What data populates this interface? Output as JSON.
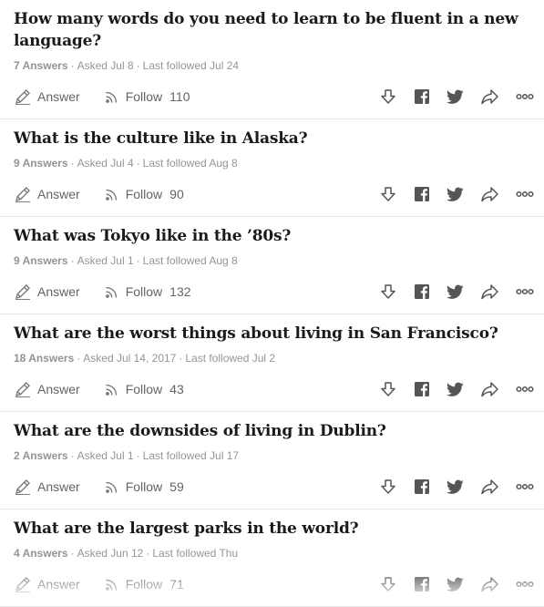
{
  "questions": [
    {
      "title": "How many words do you need to learn to be fluent in a new language?",
      "answers": "7 Answers",
      "asked": "Asked Jul 8",
      "followed": "Last followed Jul 24",
      "answer_label": "Answer",
      "follow_label": "Follow",
      "follow_count": "110"
    },
    {
      "title": "What is the culture like in Alaska?",
      "answers": "9 Answers",
      "asked": "Asked Jul 4",
      "followed": "Last followed Aug 8",
      "answer_label": "Answer",
      "follow_label": "Follow",
      "follow_count": "90"
    },
    {
      "title": "What was Tokyo like in the ’80s?",
      "answers": "9 Answers",
      "asked": "Asked Jul 1",
      "followed": "Last followed Aug 8",
      "answer_label": "Answer",
      "follow_label": "Follow",
      "follow_count": "132"
    },
    {
      "title": "What are the worst things about living in San Francisco?",
      "answers": "18 Answers",
      "asked": "Asked Jul 14, 2017",
      "followed": "Last followed Jul 2",
      "answer_label": "Answer",
      "follow_label": "Follow",
      "follow_count": "43"
    },
    {
      "title": "What are the downsides of living in Dublin?",
      "answers": "2 Answers",
      "asked": "Asked Jul 1",
      "followed": "Last followed Jul 17",
      "answer_label": "Answer",
      "follow_label": "Follow",
      "follow_count": "59"
    },
    {
      "title": "What are the largest parks in the world?",
      "answers": "4 Answers",
      "asked": "Asked Jun 12",
      "followed": "Last followed Thu",
      "answer_label": "Answer",
      "follow_label": "Follow",
      "follow_count": "71"
    }
  ],
  "icons": {
    "answer": "pencil-icon",
    "follow": "follow-signal-icon",
    "downvote": "downvote-arrow-icon",
    "facebook": "facebook-icon",
    "twitter": "twitter-icon",
    "share": "share-arrow-icon",
    "more": "more-dots-icon"
  },
  "colors": {
    "text": "#282829",
    "meta": "#939598",
    "icon": "#636466",
    "divider": "#e6e6e6"
  }
}
